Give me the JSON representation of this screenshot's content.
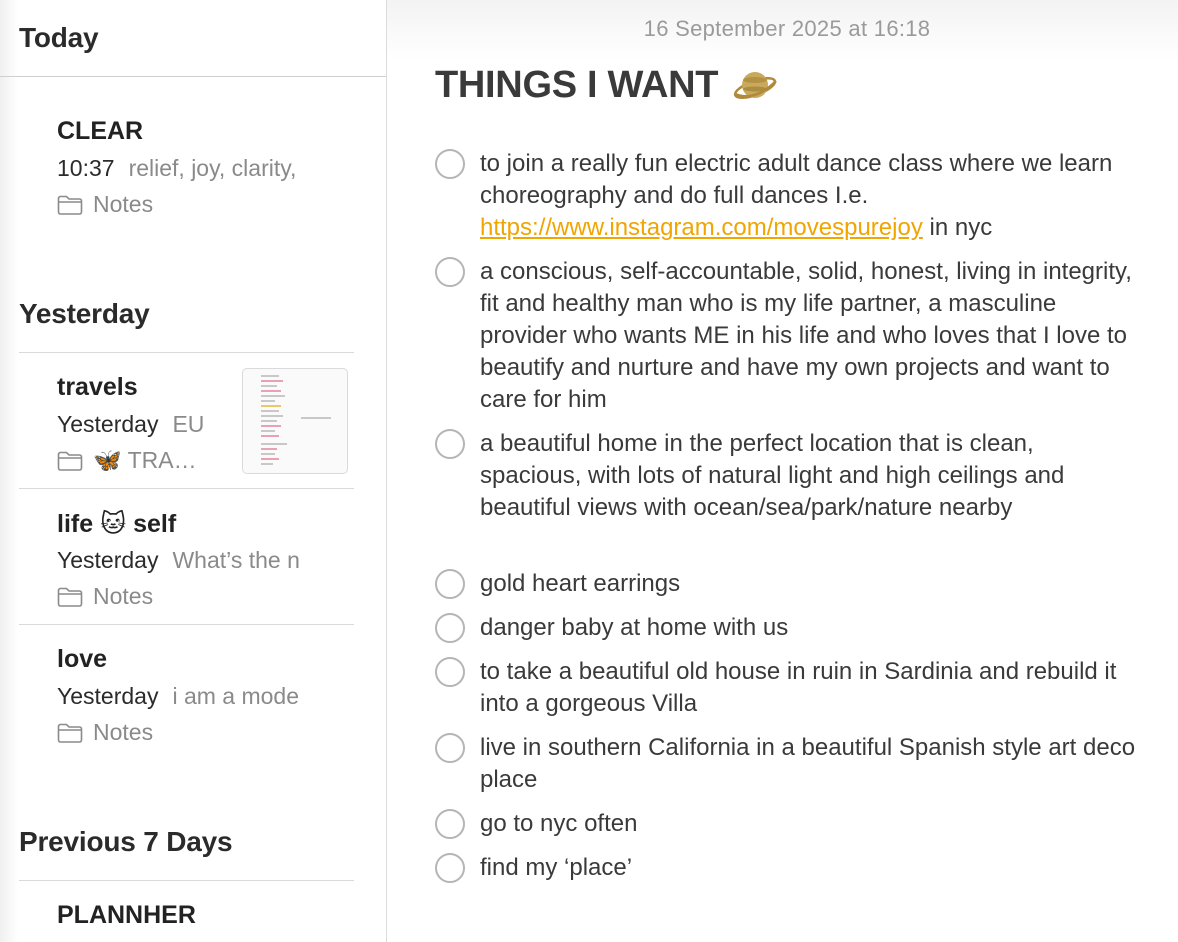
{
  "sidebar": {
    "sections": [
      "Today",
      "Yesterday",
      "Previous 7 Days"
    ],
    "notes": [
      {
        "title": "CLEAR",
        "time": "10:37",
        "preview": "relief, joy, clarity,",
        "folder": "Notes"
      },
      {
        "title": "travels",
        "time": "Yesterday",
        "preview": "EU",
        "folder": "🦋 TRA…"
      },
      {
        "title": "life 🐱 self",
        "time": "Yesterday",
        "preview": "What’s the n",
        "folder": "Notes"
      },
      {
        "title": "love",
        "time": "Yesterday",
        "preview": "i am a mode",
        "folder": "Notes"
      },
      {
        "title": "PLANNHER"
      }
    ]
  },
  "note": {
    "date": "16 September 2025 at 16:18",
    "title": "THINGS I WANT",
    "title_emoji": "planet-emoji",
    "items": [
      {
        "text_before": "to join a really fun electric adult dance class where we learn choreography and do full dances I.e. ",
        "link": "https://www.instagram.com/movespurejoy",
        "text_after": " in nyc"
      },
      {
        "text": "a conscious, self-accountable, solid, honest, living in integrity, fit and healthy man who is my life partner, a masculine provider who wants ME in his life and who loves that I love to beautify and nurture and have my own projects and want to care for him"
      },
      {
        "text": "a beautiful home in the perfect location that is clean, spacious, with lots of natural light and high ceilings and beautiful views with ocean/sea/park/nature nearby"
      },
      {
        "text": "gold heart earrings"
      },
      {
        "text": "danger baby at home with us"
      },
      {
        "text": "to take a beautiful old house in ruin in Sardinia and rebuild it into a gorgeous Villa"
      },
      {
        "text": "live in southern California in a beautiful Spanish style art deco place"
      },
      {
        "text": "go to nyc often"
      },
      {
        "text": "find my ‘place’"
      }
    ]
  },
  "colors": {
    "link": "#f0a500",
    "checkbox": "#b5b5b5",
    "meta_gray": "#8a8a8a"
  }
}
